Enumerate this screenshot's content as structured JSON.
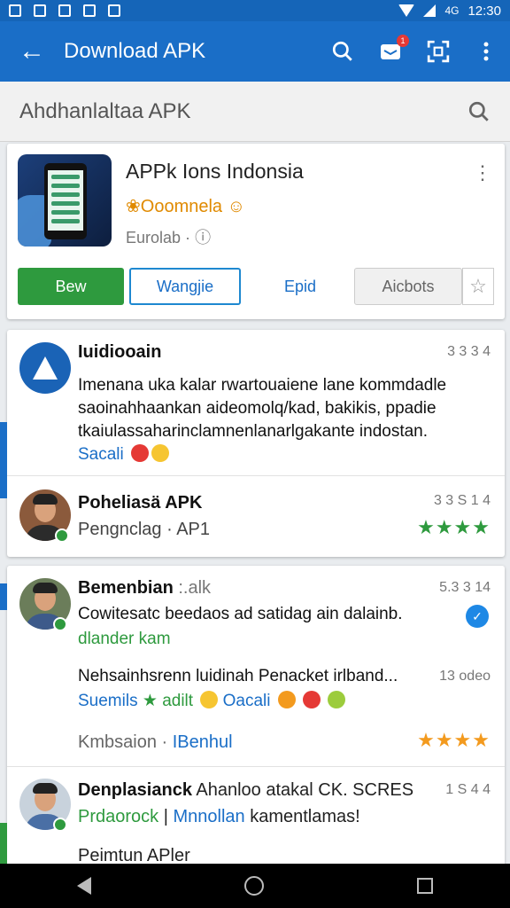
{
  "statusbar": {
    "time": "12:30",
    "network": "4G"
  },
  "appbar": {
    "title": "Download APK",
    "notification_count": "1"
  },
  "search": {
    "placeholder": "Ahdhanlaltaa APK"
  },
  "app": {
    "name": "APPk Ions Indonsia",
    "developer": "Ooomnela",
    "meta": "Eurolab ·",
    "buttons": {
      "primary": "Bew",
      "outline": "Wangjie",
      "text": "Epid",
      "grey": "Aicbots"
    }
  },
  "posts": [
    {
      "author": "Iuidiooain",
      "time": "3 3 3 4",
      "lines": [
        "Imenana uka kalar rwartouaiene lane kommdadle",
        "saoinahhaankan aideomolq/kad, bakikis, ppadie",
        "tkaiulassaharinclamnenlanarlgakante indostan."
      ],
      "footer": "Sacali"
    },
    {
      "author": "Poheliasä APK",
      "time": "3 3 S 1 4",
      "subtitle": "Pengnclag · AP1",
      "stars": "★★★★"
    },
    {
      "author": "Bemenbian",
      "author_suffix": ":.alk",
      "time": "5.3 3 14",
      "line1": "Cowitesatc beedaos ad satidag ain dalainb.",
      "line2": "dlander kam",
      "line3": "Nehsainhsrenn luidinah Penacket irlband...",
      "line3_time": "13 odeo",
      "tags": "Suemils",
      "tag2": "adilt",
      "tag3": "Oacali",
      "footer_left": "Kmbsaion",
      "footer_right": "IBenhul",
      "stars": "★★★★"
    },
    {
      "author": "Denplasianck",
      "author_rest": "Ahanloo atakal CK. SCRES",
      "time": "1 S 4 4",
      "line1a": "Prdaorock",
      "line1b": "Mnnollan",
      "line1c": "kamentlamas!",
      "line2": "Peimtun APler"
    }
  ]
}
